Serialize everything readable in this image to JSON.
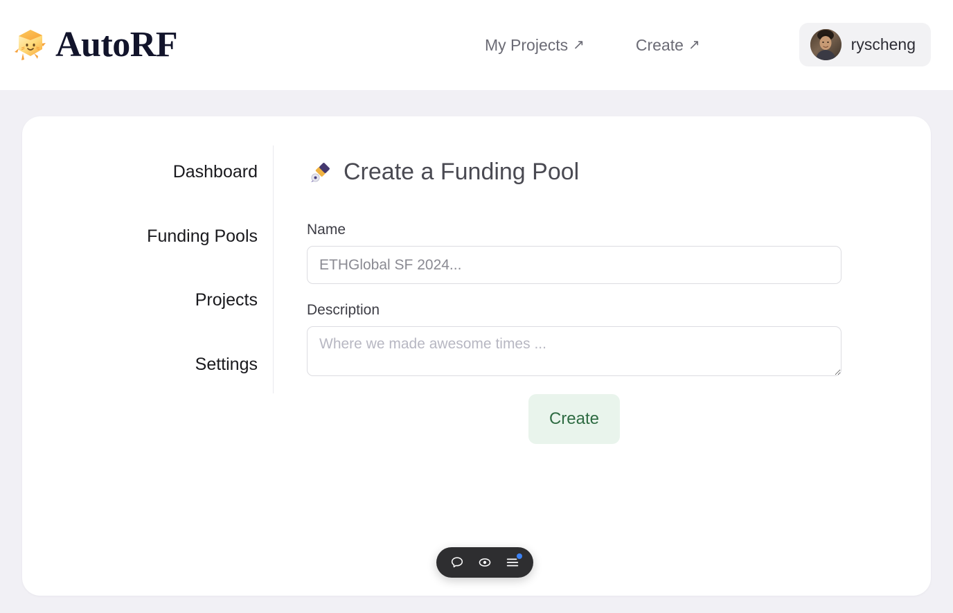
{
  "header": {
    "brand": {
      "name": "AutoRF",
      "mascot_icon": "cube-mascot-icon"
    },
    "nav": [
      {
        "label": "My Projects",
        "arrow": "↗",
        "icon": "external-link-arrow-icon"
      },
      {
        "label": "Create",
        "arrow": "↗",
        "icon": "external-link-arrow-icon"
      }
    ],
    "user": {
      "username": "ryscheng",
      "avatar_icon": "user-avatar-photo"
    }
  },
  "sidebar": {
    "items": [
      {
        "label": "Dashboard"
      },
      {
        "label": "Funding Pools"
      },
      {
        "label": "Projects"
      },
      {
        "label": "Settings"
      }
    ]
  },
  "main": {
    "title": "Create a Funding Pool",
    "title_emoji": "fountain-pen-icon",
    "form": {
      "name": {
        "label": "Name",
        "value": "",
        "placeholder": "ETHGlobal SF 2024..."
      },
      "description": {
        "label": "Description",
        "value": "",
        "placeholder": "Where we made awesome times ..."
      },
      "submit_label": "Create"
    }
  },
  "toolbar": {
    "buttons": [
      {
        "icon": "comment-bubble-icon",
        "badge": false
      },
      {
        "icon": "eye-icon",
        "badge": false
      },
      {
        "icon": "menu-lines-icon",
        "badge": true
      }
    ]
  },
  "colors": {
    "page_background": "#f1f0f5",
    "card_background": "#ffffff",
    "brand_text": "#12142b",
    "nav_text": "#6b6b75",
    "create_button_bg": "#e9f4ec",
    "create_button_text": "#2e6b42",
    "toolbar_bg": "#2e2e30",
    "badge_dot": "#3b82f6"
  }
}
